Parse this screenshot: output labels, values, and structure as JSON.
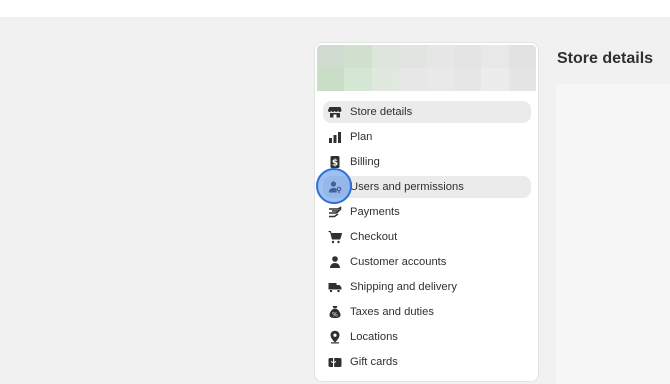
{
  "settings_nav": {
    "items": [
      {
        "label": "Store details",
        "icon": "store-icon",
        "state": "active"
      },
      {
        "label": "Plan",
        "icon": "plan-chart-icon",
        "state": "default"
      },
      {
        "label": "Billing",
        "icon": "billing-dollar-icon",
        "state": "default"
      },
      {
        "label": "Users and permissions",
        "icon": "users-permissions-icon",
        "state": "hover"
      },
      {
        "label": "Payments",
        "icon": "payments-hand-icon",
        "state": "default"
      },
      {
        "label": "Checkout",
        "icon": "cart-icon",
        "state": "default"
      },
      {
        "label": "Customer accounts",
        "icon": "person-icon",
        "state": "default"
      },
      {
        "label": "Shipping and delivery",
        "icon": "truck-icon",
        "state": "default"
      },
      {
        "label": "Taxes and duties",
        "icon": "tax-bag-icon",
        "state": "default"
      },
      {
        "label": "Locations",
        "icon": "location-pin-icon",
        "state": "default"
      },
      {
        "label": "Gift cards",
        "icon": "gift-card-icon",
        "state": "default"
      }
    ]
  },
  "main": {
    "page_title": "Store details"
  },
  "colors": {
    "page_bg": "#f1f1f1",
    "panel_bg": "#ffffff",
    "active_bg": "#ebebeb",
    "text": "#303030",
    "cursor_fill": "#4f8ce8"
  }
}
